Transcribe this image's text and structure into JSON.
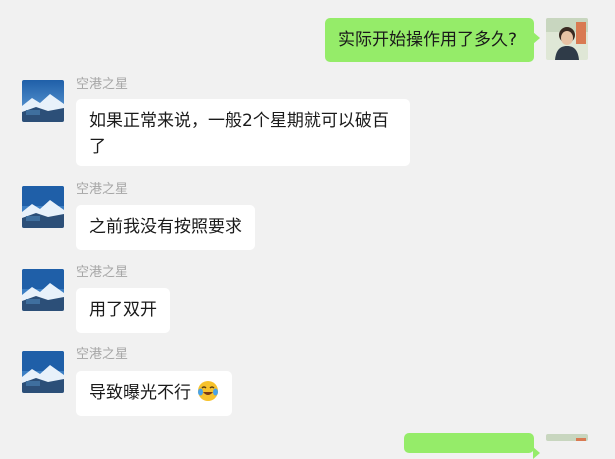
{
  "chat": {
    "messages": [
      {
        "side": "out",
        "text": "实际开始操作用了多久?"
      },
      {
        "side": "in",
        "sender": "空港之星",
        "text": "如果正常来说，一般2个星期就可以破百了"
      },
      {
        "side": "in",
        "sender": "空港之星",
        "text": "之前我没有按照要求"
      },
      {
        "side": "in",
        "sender": "空港之星",
        "text": "用了双开"
      },
      {
        "side": "in",
        "sender": "空港之星",
        "text": "导致曝光不行",
        "emoji": "crying-laughing-emoji"
      }
    ]
  },
  "colors": {
    "background": "#f1f1f1",
    "outgoing_bubble": "#95ec69",
    "incoming_bubble": "#ffffff",
    "sender_name": "#a6a6a6"
  },
  "icons": {
    "self_avatar": "user-photo-avatar",
    "contact_avatar": "landscape-avatar"
  }
}
